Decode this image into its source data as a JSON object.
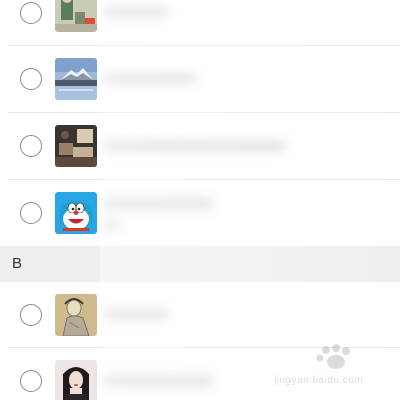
{
  "section": {
    "letter": "B"
  },
  "contacts": [
    {
      "avatar": "cartoon-figure-avatar",
      "name": "●●●●●●●"
    },
    {
      "avatar": "mountain-lake-avatar",
      "name": "●●●●●●●●●●"
    },
    {
      "avatar": "room-photo-avatar",
      "name": "●●●●●●●●●●●●●●●●●●●●"
    },
    {
      "avatar": "doraemon-avatar",
      "name": "●●●●●●●●●●●●",
      "sub": "●●"
    },
    {
      "avatar": "sketch-girl-avatar",
      "name": "●●●●●●●"
    },
    {
      "avatar": "dark-hair-girl-avatar",
      "name": "●●●●●●●●●●●●"
    }
  ],
  "colors": {
    "section_bg": "#efefef",
    "divider": "#e9e9e9",
    "radio_border": "#8a8a8a",
    "doraemon_blue": "#1e9fd8"
  },
  "watermark": {
    "text": "jingyan.baidu.com"
  }
}
